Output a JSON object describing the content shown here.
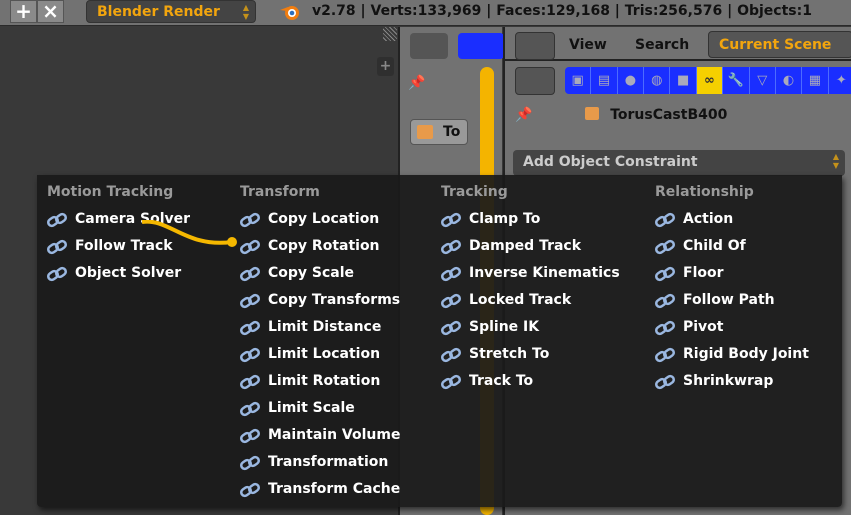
{
  "topbar": {
    "add_icon": "plus-icon",
    "close_icon": "x-icon",
    "render_engine": "Blender Render",
    "stats": "v2.78 | Verts:133,969 | Faces:129,168 | Tris:256,576 | Objects:1"
  },
  "properties_panel": {
    "transform_label": "To"
  },
  "outliner": {
    "view": "View",
    "search": "Search",
    "scene": "Current Scene"
  },
  "properties": {
    "tabs": [
      "render",
      "render-layers",
      "scene",
      "world",
      "object",
      "constraints",
      "modifiers",
      "data",
      "material",
      "texture",
      "particles"
    ],
    "active_tab": "constraints",
    "object_name": "TorusCastB400",
    "add_constraint": "Add Object Constraint"
  },
  "menu": {
    "columns": [
      {
        "title": "Motion Tracking",
        "items": [
          "Camera Solver",
          "Follow Track",
          "Object Solver"
        ]
      },
      {
        "title": "Transform",
        "items": [
          "Copy Location",
          "Copy Rotation",
          "Copy Scale",
          "Copy Transforms",
          "Limit Distance",
          "Limit Location",
          "Limit Rotation",
          "Limit Scale",
          "Maintain Volume",
          "Transformation",
          "Transform Cache"
        ]
      },
      {
        "title": "Tracking",
        "items": [
          "Clamp To",
          "Damped Track",
          "Inverse Kinematics",
          "Locked Track",
          "Spline IK",
          "Stretch To",
          "Track To"
        ]
      },
      {
        "title": "Relationship",
        "items": [
          "Action",
          "Child Of",
          "Floor",
          "Follow Path",
          "Pivot",
          "Rigid Body Joint",
          "Shrinkwrap"
        ]
      }
    ]
  },
  "colors": {
    "accent": "#f2a50e",
    "tab_bar": "#1a2eff",
    "active_tab": "#f5d000",
    "menu_bg": "#1a1a1a"
  }
}
